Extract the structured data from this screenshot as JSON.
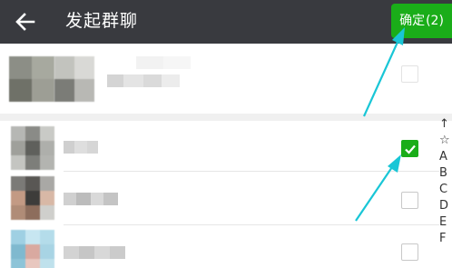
{
  "header": {
    "title": "发起群聊",
    "back_icon": "arrow-left-icon",
    "confirm_label": "确定",
    "confirm_count": "(2)"
  },
  "contacts": [
    {
      "checked": false
    },
    {
      "checked": true
    },
    {
      "checked": false
    },
    {
      "checked": false
    }
  ],
  "index_letters": [
    "↑",
    "☆",
    "A",
    "B",
    "C",
    "D",
    "E",
    "F"
  ],
  "colors": {
    "header_bg": "#393a3f",
    "accent_green": "#1aad19",
    "annotation_arrow": "#19c6d6"
  }
}
